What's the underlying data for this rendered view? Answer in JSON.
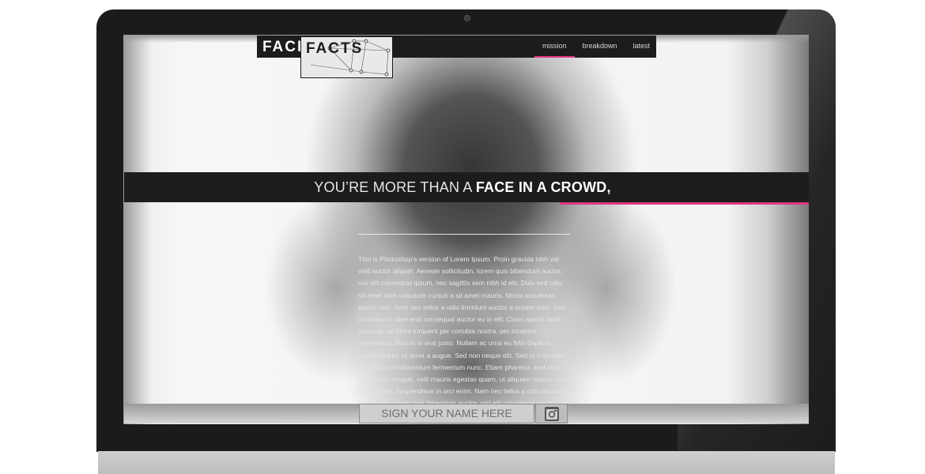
{
  "logo": {
    "face": "FACE",
    "facts": "FACTS"
  },
  "nav": {
    "items": [
      {
        "label": "mission",
        "active": true
      },
      {
        "label": "breakdown",
        "active": false
      },
      {
        "label": "latest",
        "active": false
      }
    ]
  },
  "hero": {
    "headline_light": "YOU’RE MORE THAN A ",
    "headline_bold": "FACE IN A CROWD,"
  },
  "body": {
    "paragraph": "This is Photoshop’s version of Lorem Ipsum. Proin gravida nibh vel velit auctor aliquet. Aenean sollicitudin, lorem quis bibendum auctor, nisi elit consequat ipsum, nec sagittis sem nibh id elit. Duis sed odio sit amet nibh vulputate cursus a sit amet mauris. Morbi accumsan ipsum velit. Nam nec tellus a odio tincidunt auctor a ornare odio. Sed non mauris vitae erat consequat auctor eu in elit. Class aptent taciti sociosqu ad litora torquent per conubia nostra, per inceptos himenaeos. Mauris in erat justo. Nullam ac urna eu felis dapibus condimentum sit amet a augue. Sed non neque elit. Sed ut imperdiet nisi. Proin condimentum fermentum nunc. Etiam pharetra, erat sed fermentum feugiat, velit mauris egestas quam, ut aliquam massa nisl quis neque. Suspendisse in orci enim. Nam nec tellus a odio tincidunt sollicitudin, lorem quis bibendum auctor, nisi elit consequat ipsum, nec"
  },
  "footer": {
    "sign_placeholder": "SIGN YOUR NAME HERE",
    "camera_icon": "camera-icon"
  },
  "colors": {
    "accent": "#e0387f",
    "bar": "#1d1b1c"
  }
}
